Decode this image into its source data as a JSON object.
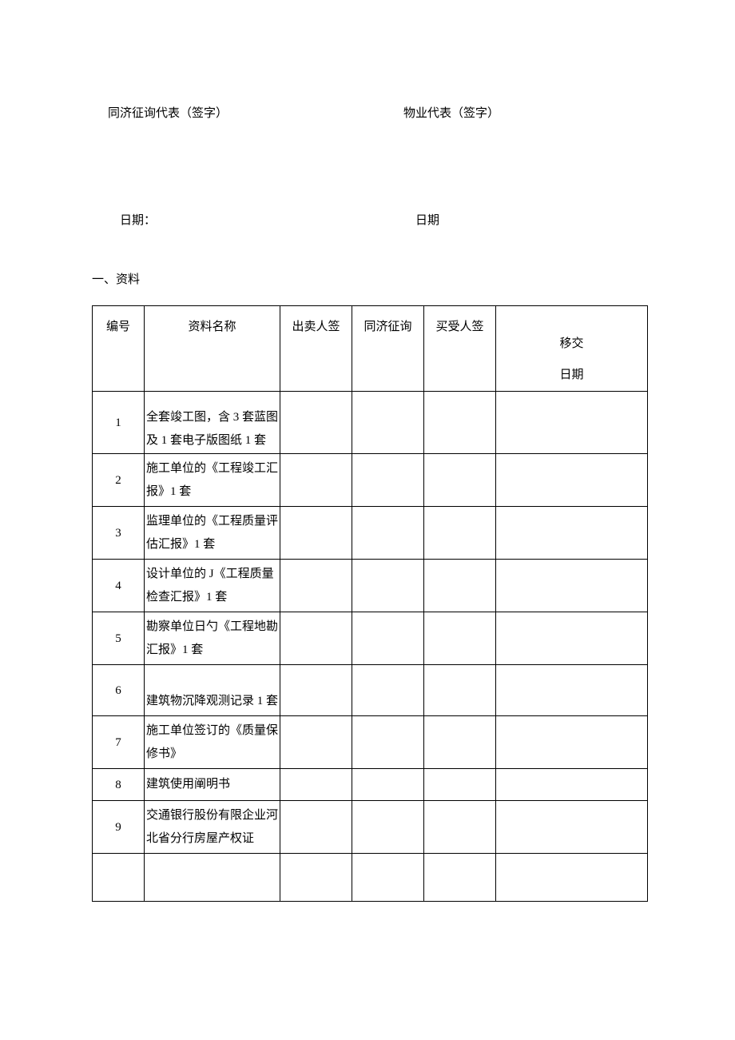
{
  "signatures": {
    "left_label": "同济征询代表（签字）",
    "right_label": "物业代表（签字）"
  },
  "dates": {
    "left_label": "日期：",
    "right_label": "日期"
  },
  "section_heading": "一、资料",
  "table": {
    "headers": {
      "num": "编号",
      "name": "资料名称",
      "seller": "出卖人签",
      "tongji": "同济征询",
      "buyer": "买受人签",
      "date": "移交\n日期"
    },
    "rows": [
      {
        "num": "1",
        "name": "全套竣工图，含 3 套蓝图及 1 套电子版图纸 1 套"
      },
      {
        "num": "2",
        "name": "施工单位的《工程竣工汇报》1 套"
      },
      {
        "num": "3",
        "name": "监理单位的《工程质量评估汇报》1 套"
      },
      {
        "num": "4",
        "name": "设计单位的 J《工程质量检查汇报》1 套"
      },
      {
        "num": "5",
        "name": "勘察单位日勺《工程地勘汇报》1 套"
      },
      {
        "num": "6",
        "name": "建筑物沉降观测记录 1 套"
      },
      {
        "num": "7",
        "name": "施工单位签订的《质量保修书》"
      },
      {
        "num": "8",
        "name": "建筑使用阐明书"
      },
      {
        "num": "9",
        "name": "交通银行股份有限企业河北省分行房屋产权证"
      },
      {
        "num": "",
        "name": ""
      }
    ]
  }
}
